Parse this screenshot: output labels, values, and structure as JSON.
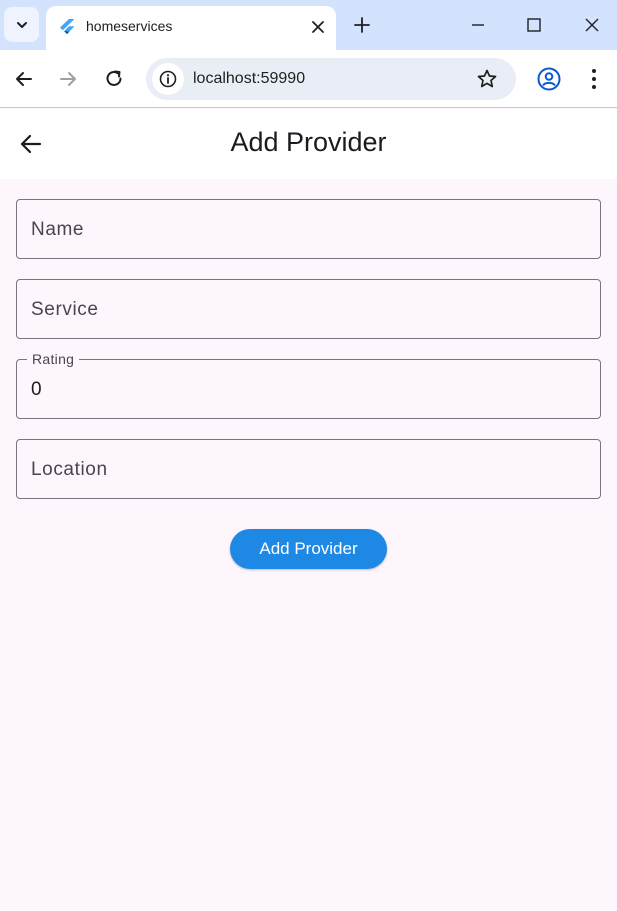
{
  "browser": {
    "tab_title": "homeservices",
    "url": "localhost:59990",
    "icons": {
      "tab_search": "chevron-down-icon",
      "favicon": "flutter-icon",
      "tab_close": "close-icon",
      "new_tab": "plus-icon",
      "minimize": "minimize-icon",
      "maximize": "maximize-icon",
      "close_window": "close-icon",
      "back": "arrow-left-icon",
      "forward": "arrow-right-icon",
      "reload": "reload-icon",
      "site_info": "info-icon",
      "bookmark": "star-icon",
      "profile": "profile-icon",
      "menu": "kebab-menu-icon"
    }
  },
  "app": {
    "appbar": {
      "title": "Add Provider",
      "back_icon": "arrow-left-icon"
    },
    "form": {
      "name": {
        "placeholder": "Name",
        "value": ""
      },
      "service": {
        "placeholder": "Service",
        "value": ""
      },
      "rating": {
        "label": "Rating",
        "value": "0"
      },
      "location": {
        "placeholder": "Location",
        "value": ""
      }
    },
    "submit_label": "Add Provider",
    "colors": {
      "accent": "#1e88e5",
      "background": "#fdf7fd",
      "tabstrip": "#d3e3fd",
      "outline": "#79747e"
    }
  }
}
